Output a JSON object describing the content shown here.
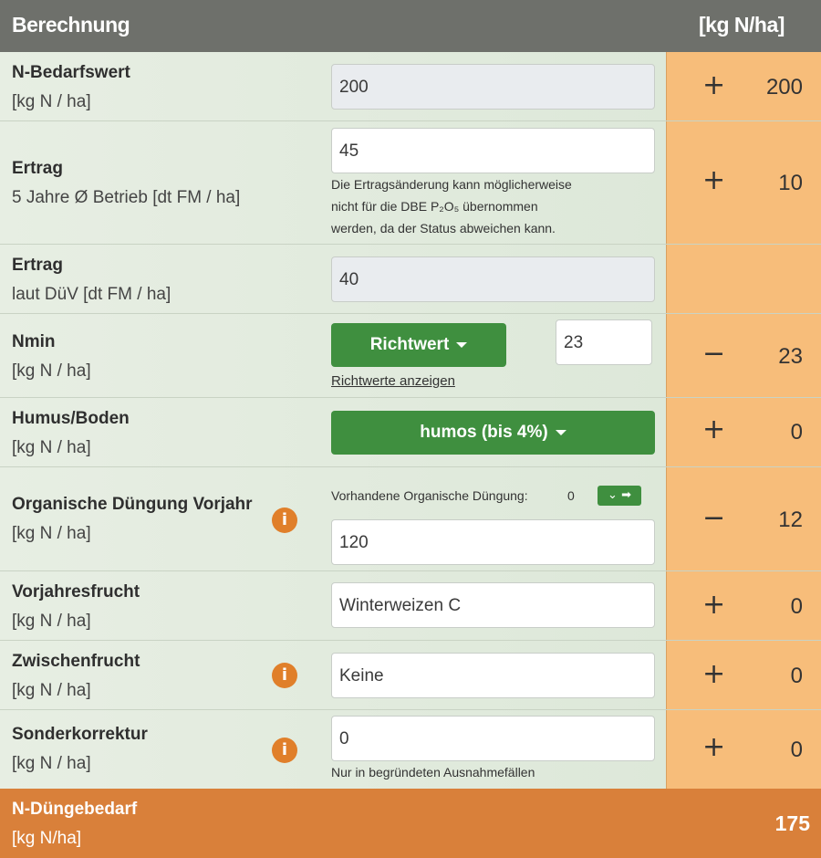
{
  "header": {
    "title": "Berechnung",
    "unit": "[kg N/ha]"
  },
  "rows": {
    "bedarf": {
      "label": "N-Bedarfswert",
      "sublabel": "[kg N / ha]",
      "input": "200",
      "sign": "+",
      "value": "200"
    },
    "ertrag_betrieb": {
      "label": "Ertrag",
      "sublabel": "5 Jahre Ø Betrieb [dt FM / ha]",
      "input": "45",
      "note_lines": [
        "Die Ertragsänderung kann möglicherweise",
        "nicht für die DBE P₂O₅ übernommen",
        "werden, da der Status abweichen kann."
      ],
      "sign": "+",
      "value": "10"
    },
    "ertrag_duev": {
      "label": "Ertrag",
      "sublabel": "laut DüV [dt FM / ha]",
      "input": "40"
    },
    "nmin": {
      "label": "Nmin",
      "sublabel": "[kg N / ha]",
      "button": "Richtwert",
      "input": "23",
      "link": "Richtwerte anzeigen",
      "sign": "−",
      "value": "23"
    },
    "humus": {
      "label": "Humus/Boden",
      "sublabel": "[kg N / ha]",
      "select": "humos (bis 4%)",
      "sign": "+",
      "value": "0"
    },
    "organisch": {
      "label": "Organische Düngung Vorjahr",
      "sublabel": "[kg N / ha]",
      "vorhanden_label": "Vorhandene Organische Düngung:",
      "vorhanden_value": "0",
      "input": "120",
      "sign": "−",
      "value": "12"
    },
    "vorjahresfrucht": {
      "label": "Vorjahresfrucht",
      "sublabel": "[kg N / ha]",
      "input": "Winterweizen C",
      "sign": "+",
      "value": "0"
    },
    "zwischenfrucht": {
      "label": "Zwischenfrucht",
      "sublabel": "[kg N / ha]",
      "input": "Keine",
      "sign": "+",
      "value": "0"
    },
    "sonder": {
      "label": "Sonderkorrektur",
      "sublabel": "[kg N / ha]",
      "input": "0",
      "note": "Nur in begründeten Ausnahmefällen",
      "sign": "+",
      "value": "0"
    }
  },
  "footer": {
    "label": "N-Düngebedarf",
    "unit": "[kg N/ha]",
    "value": "175"
  },
  "icons": {
    "info": "i"
  },
  "colors": {
    "header": "#6e706b",
    "accent_green": "#3f8f3f",
    "value_column": "#f7bd7a",
    "footer": "#d9803a",
    "info_icon": "#e07f2a"
  }
}
